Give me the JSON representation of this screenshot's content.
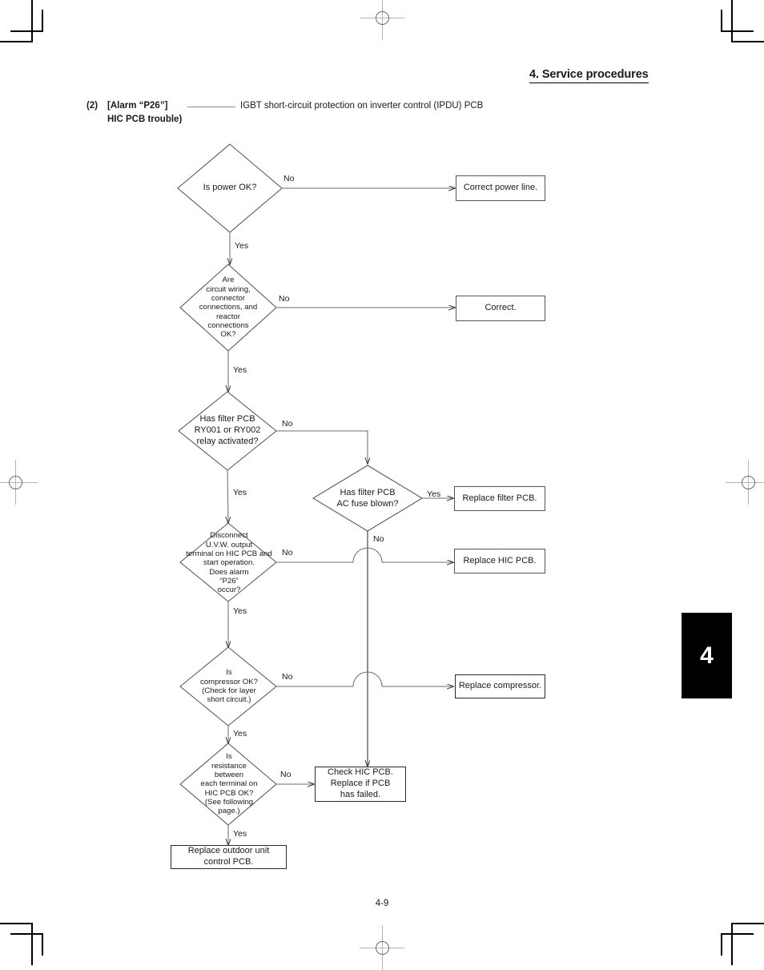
{
  "page": {
    "header_title": "4. Service procedures",
    "footer_page": "4-9",
    "section_tab": "4"
  },
  "caption": {
    "number": "(2)",
    "alarm_line1": "[Alarm “P26”]",
    "alarm_line2": "HIC PCB trouble)",
    "description": "IGBT short-circuit protection on inverter control (IPDU) PCB"
  },
  "flowchart": {
    "decisions": [
      {
        "id": "d1",
        "text": "Is power OK?"
      },
      {
        "id": "d2",
        "text": "Are\ncircuit wiring,\nconnector\nconnections, and\nreactor\nconnections\nOK?"
      },
      {
        "id": "d3",
        "text": "Has filter PCB\nRY001 or RY002\nrelay activated?"
      },
      {
        "id": "d4",
        "text": "Has filter PCB\nAC fuse blown?"
      },
      {
        "id": "d5",
        "text": "Disconnect\nU.V.W. output\nterminal on HIC PCB and\nstart operation.\nDoes alarm\n“P26”\noccur?"
      },
      {
        "id": "d6",
        "text": "Is\ncompressor OK?\n(Check for layer\nshort circuit.)"
      },
      {
        "id": "d7",
        "text": "Is\nresistance\nbetween\neach terminal on\nHIC PCB OK?\n(See following\npage.)"
      }
    ],
    "results": [
      {
        "id": "r1",
        "text": "Correct power line."
      },
      {
        "id": "r2",
        "text": "Correct."
      },
      {
        "id": "r3",
        "text": "Replace filter PCB."
      },
      {
        "id": "r4",
        "text": "Replace HIC PCB."
      },
      {
        "id": "r5",
        "text": "Replace compressor."
      },
      {
        "id": "r6",
        "text": "Check HIC PCB.\nReplace if PCB\nhas failed."
      },
      {
        "id": "r7",
        "text": "Replace outdoor unit\ncontrol PCB."
      }
    ],
    "edge_labels": {
      "d1_no": "No",
      "d1_yes": "Yes",
      "d2_no": "No",
      "d2_yes": "Yes",
      "d3_no": "No",
      "d3_yes": "Yes",
      "d4_yes": "Yes",
      "d4_no": "No",
      "d5_no": "No",
      "d5_yes": "Yes",
      "d6_no": "No",
      "d6_yes": "Yes",
      "d7_no": "No",
      "d7_yes": "Yes"
    }
  }
}
